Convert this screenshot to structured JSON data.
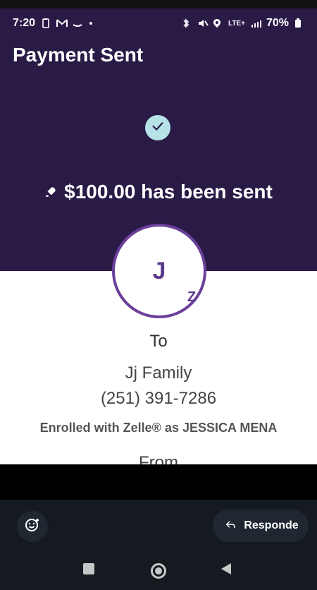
{
  "status_bar": {
    "time": "7:20",
    "network": "LTE+",
    "battery": "70%",
    "left_icons": [
      "battery-saver-icon",
      "gmail-icon",
      "amazon-icon",
      "dot-icon"
    ],
    "right_icons": [
      "bluetooth-icon",
      "mute-icon",
      "location-icon",
      "signal-icon",
      "battery-icon"
    ]
  },
  "header": {
    "title": "Payment Sent"
  },
  "confirmation": {
    "amount_text": "$100.00 has been sent"
  },
  "recipient": {
    "initial": "J",
    "zelle_badge": "Z",
    "to_label": "To",
    "name": "Jj Family",
    "phone": "(251) 391-7286",
    "enrolled_text": "Enrolled with Zelle® as JESSICA MENA",
    "from_label": "From"
  },
  "bottom_actions": {
    "respond_label": "Responde"
  },
  "colors": {
    "primary_purple": "#2a1a46",
    "accent_purple": "#6b3f9a",
    "check_bg": "#b7e3e8",
    "bottom_bg": "#141a1f"
  }
}
